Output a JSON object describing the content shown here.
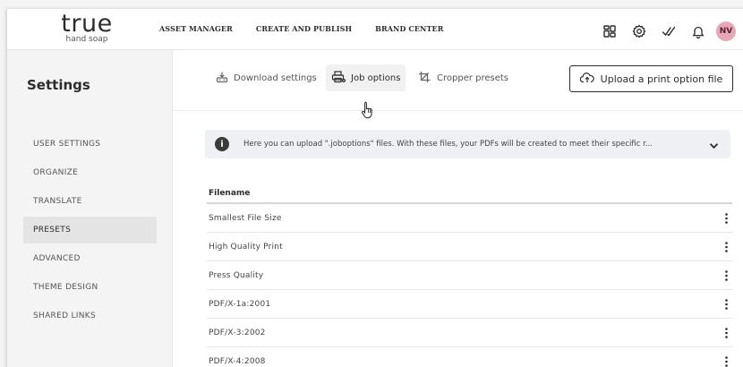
{
  "brand": {
    "name": "true",
    "tagline": "hand soap"
  },
  "topnav": [
    {
      "label": "ASSET MANAGER"
    },
    {
      "label": "CREATE AND PUBLISH"
    },
    {
      "label": "BRAND CENTER"
    }
  ],
  "topicons": [
    "apps-grid-icon",
    "gear-icon",
    "checkmark-icon",
    "bell-icon"
  ],
  "user": {
    "initials": "NV",
    "avatar_color": "#e6a7b6"
  },
  "sidebar": {
    "title": "Settings",
    "items": [
      {
        "label": "USER SETTINGS",
        "active": false
      },
      {
        "label": "ORGANIZE",
        "active": false
      },
      {
        "label": "TRANSLATE",
        "active": false
      },
      {
        "label": "PRESETS",
        "active": true
      },
      {
        "label": "ADVANCED",
        "active": false
      },
      {
        "label": "THEME DESIGN",
        "active": false
      },
      {
        "label": "SHARED LINKS",
        "active": false
      }
    ]
  },
  "tabs": [
    {
      "label": "Download settings",
      "icon": "download-settings-icon",
      "active": false
    },
    {
      "label": "Job options",
      "icon": "printer-icon",
      "active": true
    },
    {
      "label": "Cropper presets",
      "icon": "crop-icon",
      "active": false
    }
  ],
  "upload_button": {
    "label": "Upload a print option file",
    "icon": "cloud-upload-icon"
  },
  "info_banner": {
    "text": "Here you can upload \".joboptions\" files. With these files, your PDFs will be created to meet their specific r..."
  },
  "table": {
    "columns": [
      "Filename"
    ],
    "rows": [
      {
        "filename": "Smallest File Size"
      },
      {
        "filename": "High Quality Print"
      },
      {
        "filename": "Press Quality"
      },
      {
        "filename": "PDF/X-1a:2001"
      },
      {
        "filename": "PDF/X-3:2002"
      },
      {
        "filename": "PDF/X-4:2008"
      }
    ]
  },
  "colors": {
    "sidebar_bg": "#f4f4f4",
    "active_item_bg": "#e4e4e4",
    "banner_bg": "#eef0f3",
    "text_dark": "#2c2c2c"
  }
}
